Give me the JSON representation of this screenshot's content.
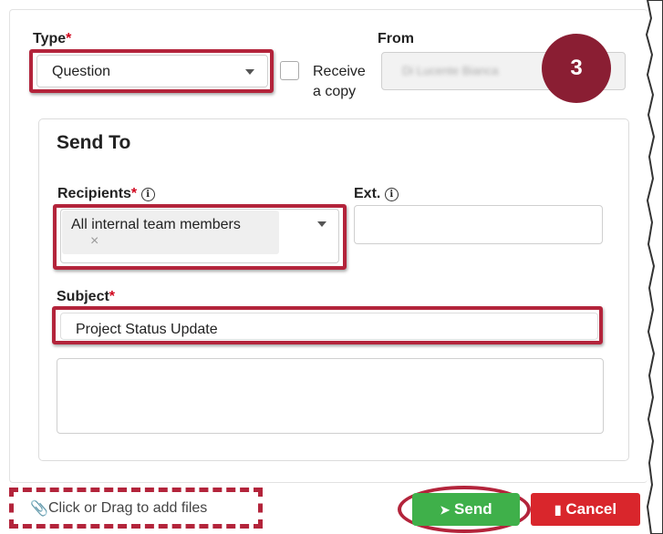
{
  "form": {
    "type": {
      "label": "Type",
      "required_mark": "*",
      "value": "Question"
    },
    "receive_copy": {
      "label_line1": "Receive",
      "label_line2": "a copy"
    },
    "from": {
      "label": "From",
      "value": "Di Lucente Bianca"
    },
    "step_badge": "3"
  },
  "send_to": {
    "title": "Send To",
    "recipients": {
      "label": "Recipients",
      "required_mark": "*",
      "info_icon": "info-icon",
      "tag": "All internal team members",
      "remove_glyph": "×"
    },
    "ext": {
      "label": "Ext.",
      "info_icon": "info-icon",
      "value": ""
    },
    "subject": {
      "label": "Subject",
      "required_mark": "*",
      "value": "Project Status Update"
    },
    "message": {
      "value": ""
    }
  },
  "footer": {
    "attach_label": "Click or Drag to add files",
    "send_label": "Send",
    "cancel_label": "Cancel"
  },
  "colors": {
    "highlight": "#b3243b",
    "badge": "#8a1e33",
    "send": "#3fb04a",
    "cancel": "#d9262c"
  }
}
